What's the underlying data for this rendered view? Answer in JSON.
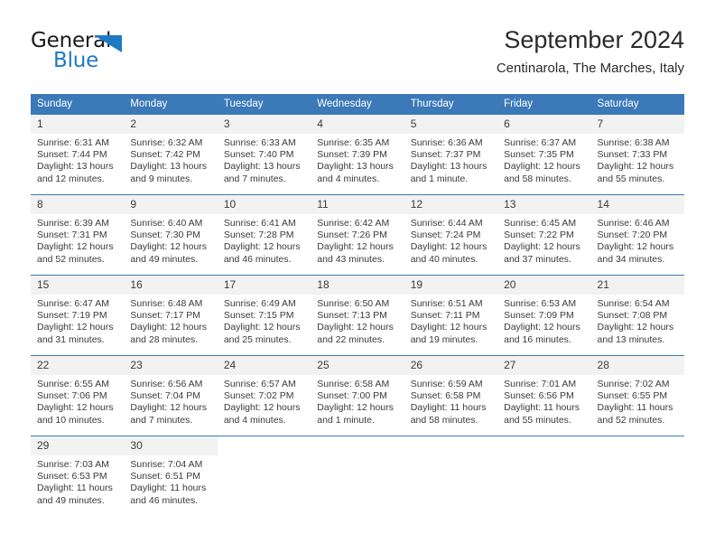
{
  "brand": {
    "name_top": "General",
    "name_bottom": "Blue",
    "accent_color": "#1f7ac4"
  },
  "header": {
    "title": "September 2024",
    "subtitle": "Centinarola, The Marches, Italy"
  },
  "calendar": {
    "header_color": "#3b79b8",
    "daynum_band_color": "#f2f2f2",
    "weekday_names": [
      "Sunday",
      "Monday",
      "Tuesday",
      "Wednesday",
      "Thursday",
      "Friday",
      "Saturday"
    ],
    "weeks": [
      [
        {
          "day": "1",
          "sunrise": "Sunrise: 6:31 AM",
          "sunset": "Sunset: 7:44 PM",
          "daylight": "Daylight: 13 hours and 12 minutes."
        },
        {
          "day": "2",
          "sunrise": "Sunrise: 6:32 AM",
          "sunset": "Sunset: 7:42 PM",
          "daylight": "Daylight: 13 hours and 9 minutes."
        },
        {
          "day": "3",
          "sunrise": "Sunrise: 6:33 AM",
          "sunset": "Sunset: 7:40 PM",
          "daylight": "Daylight: 13 hours and 7 minutes."
        },
        {
          "day": "4",
          "sunrise": "Sunrise: 6:35 AM",
          "sunset": "Sunset: 7:39 PM",
          "daylight": "Daylight: 13 hours and 4 minutes."
        },
        {
          "day": "5",
          "sunrise": "Sunrise: 6:36 AM",
          "sunset": "Sunset: 7:37 PM",
          "daylight": "Daylight: 13 hours and 1 minute."
        },
        {
          "day": "6",
          "sunrise": "Sunrise: 6:37 AM",
          "sunset": "Sunset: 7:35 PM",
          "daylight": "Daylight: 12 hours and 58 minutes."
        },
        {
          "day": "7",
          "sunrise": "Sunrise: 6:38 AM",
          "sunset": "Sunset: 7:33 PM",
          "daylight": "Daylight: 12 hours and 55 minutes."
        }
      ],
      [
        {
          "day": "8",
          "sunrise": "Sunrise: 6:39 AM",
          "sunset": "Sunset: 7:31 PM",
          "daylight": "Daylight: 12 hours and 52 minutes."
        },
        {
          "day": "9",
          "sunrise": "Sunrise: 6:40 AM",
          "sunset": "Sunset: 7:30 PM",
          "daylight": "Daylight: 12 hours and 49 minutes."
        },
        {
          "day": "10",
          "sunrise": "Sunrise: 6:41 AM",
          "sunset": "Sunset: 7:28 PM",
          "daylight": "Daylight: 12 hours and 46 minutes."
        },
        {
          "day": "11",
          "sunrise": "Sunrise: 6:42 AM",
          "sunset": "Sunset: 7:26 PM",
          "daylight": "Daylight: 12 hours and 43 minutes."
        },
        {
          "day": "12",
          "sunrise": "Sunrise: 6:44 AM",
          "sunset": "Sunset: 7:24 PM",
          "daylight": "Daylight: 12 hours and 40 minutes."
        },
        {
          "day": "13",
          "sunrise": "Sunrise: 6:45 AM",
          "sunset": "Sunset: 7:22 PM",
          "daylight": "Daylight: 12 hours and 37 minutes."
        },
        {
          "day": "14",
          "sunrise": "Sunrise: 6:46 AM",
          "sunset": "Sunset: 7:20 PM",
          "daylight": "Daylight: 12 hours and 34 minutes."
        }
      ],
      [
        {
          "day": "15",
          "sunrise": "Sunrise: 6:47 AM",
          "sunset": "Sunset: 7:19 PM",
          "daylight": "Daylight: 12 hours and 31 minutes."
        },
        {
          "day": "16",
          "sunrise": "Sunrise: 6:48 AM",
          "sunset": "Sunset: 7:17 PM",
          "daylight": "Daylight: 12 hours and 28 minutes."
        },
        {
          "day": "17",
          "sunrise": "Sunrise: 6:49 AM",
          "sunset": "Sunset: 7:15 PM",
          "daylight": "Daylight: 12 hours and 25 minutes."
        },
        {
          "day": "18",
          "sunrise": "Sunrise: 6:50 AM",
          "sunset": "Sunset: 7:13 PM",
          "daylight": "Daylight: 12 hours and 22 minutes."
        },
        {
          "day": "19",
          "sunrise": "Sunrise: 6:51 AM",
          "sunset": "Sunset: 7:11 PM",
          "daylight": "Daylight: 12 hours and 19 minutes."
        },
        {
          "day": "20",
          "sunrise": "Sunrise: 6:53 AM",
          "sunset": "Sunset: 7:09 PM",
          "daylight": "Daylight: 12 hours and 16 minutes."
        },
        {
          "day": "21",
          "sunrise": "Sunrise: 6:54 AM",
          "sunset": "Sunset: 7:08 PM",
          "daylight": "Daylight: 12 hours and 13 minutes."
        }
      ],
      [
        {
          "day": "22",
          "sunrise": "Sunrise: 6:55 AM",
          "sunset": "Sunset: 7:06 PM",
          "daylight": "Daylight: 12 hours and 10 minutes."
        },
        {
          "day": "23",
          "sunrise": "Sunrise: 6:56 AM",
          "sunset": "Sunset: 7:04 PM",
          "daylight": "Daylight: 12 hours and 7 minutes."
        },
        {
          "day": "24",
          "sunrise": "Sunrise: 6:57 AM",
          "sunset": "Sunset: 7:02 PM",
          "daylight": "Daylight: 12 hours and 4 minutes."
        },
        {
          "day": "25",
          "sunrise": "Sunrise: 6:58 AM",
          "sunset": "Sunset: 7:00 PM",
          "daylight": "Daylight: 12 hours and 1 minute."
        },
        {
          "day": "26",
          "sunrise": "Sunrise: 6:59 AM",
          "sunset": "Sunset: 6:58 PM",
          "daylight": "Daylight: 11 hours and 58 minutes."
        },
        {
          "day": "27",
          "sunrise": "Sunrise: 7:01 AM",
          "sunset": "Sunset: 6:56 PM",
          "daylight": "Daylight: 11 hours and 55 minutes."
        },
        {
          "day": "28",
          "sunrise": "Sunrise: 7:02 AM",
          "sunset": "Sunset: 6:55 PM",
          "daylight": "Daylight: 11 hours and 52 minutes."
        }
      ],
      [
        {
          "day": "29",
          "sunrise": "Sunrise: 7:03 AM",
          "sunset": "Sunset: 6:53 PM",
          "daylight": "Daylight: 11 hours and 49 minutes."
        },
        {
          "day": "30",
          "sunrise": "Sunrise: 7:04 AM",
          "sunset": "Sunset: 6:51 PM",
          "daylight": "Daylight: 11 hours and 46 minutes."
        },
        {
          "day": "",
          "sunrise": "",
          "sunset": "",
          "daylight": ""
        },
        {
          "day": "",
          "sunrise": "",
          "sunset": "",
          "daylight": ""
        },
        {
          "day": "",
          "sunrise": "",
          "sunset": "",
          "daylight": ""
        },
        {
          "day": "",
          "sunrise": "",
          "sunset": "",
          "daylight": ""
        },
        {
          "day": "",
          "sunrise": "",
          "sunset": "",
          "daylight": ""
        }
      ]
    ]
  }
}
